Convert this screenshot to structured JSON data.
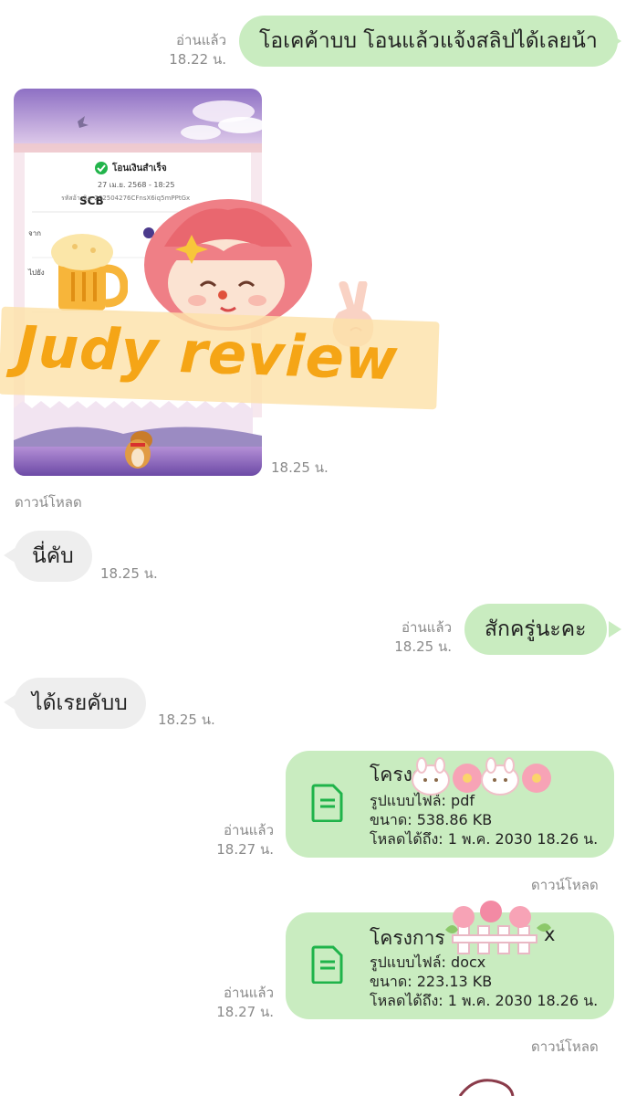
{
  "messages": [
    {
      "id": "m1",
      "side": "out",
      "text": "โอเคค้าบบ โอนแล้วแจ้งสลิปได้เลยน้า",
      "read": "อ่านแล้ว",
      "time": "18.22 น."
    },
    {
      "id": "m2",
      "side": "in",
      "type": "image",
      "time": "18.25 น.",
      "download": "ดาวน์โหลด"
    },
    {
      "id": "m3",
      "side": "in",
      "text": "นี่คับ",
      "time": "18.25 น."
    },
    {
      "id": "m4",
      "side": "out",
      "text": "สักครู่นะคะ",
      "read": "อ่านแล้ว",
      "time": "18.25 น."
    },
    {
      "id": "m5",
      "side": "in",
      "text": "ได้เรยคับบ",
      "time": "18.25 น."
    },
    {
      "id": "m6",
      "side": "out",
      "type": "file",
      "name": "โครงก",
      "format": "รูปแบบไฟล์: pdf",
      "size": "ขนาด: 538.86 KB",
      "expiry": "โหลดได้ถึง: 1 พ.ค. 2030 18.26 น.",
      "read": "อ่านแล้ว",
      "time": "18.27 น.",
      "download": "ดาวน์โหลด"
    },
    {
      "id": "m7",
      "side": "out",
      "type": "file",
      "name": "โครงการ",
      "name_suffix": "x",
      "format": "รูปแบบไฟล์: docx",
      "size": "ขนาด: 223.13 KB",
      "expiry": "โหลดได้ถึง: 1 พ.ค. 2030 18.26 น.",
      "read": "อ่านแล้ว",
      "time": "18.27 น.",
      "download": "ดาวน์โหลด"
    }
  ],
  "slip": {
    "bank": "SCB",
    "status": "โอนเงินสำเร็จ",
    "date": "27 เม.ย. 2568 - 18:25",
    "ref": "รหัสอ้างอิง: 202504276CFnsX6iq5mPPtGx",
    "from_label": "จาก",
    "to_label": "ไปยัง"
  },
  "watermark": {
    "text": "Judy review"
  },
  "colors": {
    "bubble_out": "#c9ecc0",
    "bubble_in": "#eeeeee",
    "meta": "#8a8a8a",
    "accent": "#f5a516",
    "file_icon": "#1fb34a"
  }
}
